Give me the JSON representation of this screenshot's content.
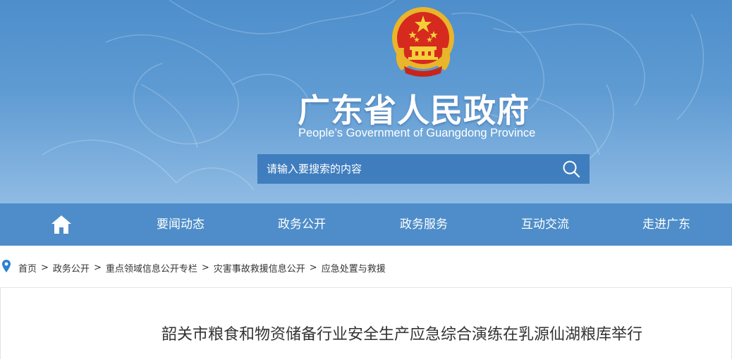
{
  "header": {
    "title": "广东省人民政府",
    "subtitle": "People’s Government of Guangdong Province",
    "emblem_icon": "national-emblem"
  },
  "search": {
    "placeholder": "请输入要搜索的内容",
    "icon": "search-icon"
  },
  "nav": {
    "home_icon": "home-icon",
    "items": [
      "要闻动态",
      "政务公开",
      "政务服务",
      "互动交流",
      "走进广东"
    ]
  },
  "breadcrumb": {
    "icon": "location-pin-icon",
    "items": [
      "首页",
      "政务公开",
      "重点领域信息公开专栏",
      "灾害事故救援信息公开",
      "应急处置与救援"
    ],
    "separator": ">"
  },
  "article": {
    "title": "韶关市粮食和物资储备行业安全生产应急综合演练在乳源仙湖粮库举行"
  },
  "colors": {
    "banner": "#5f9bd3",
    "nav": "#4e8dc9",
    "search": "#3474b8",
    "pin": "#2d7fd3",
    "text": "#333333"
  }
}
